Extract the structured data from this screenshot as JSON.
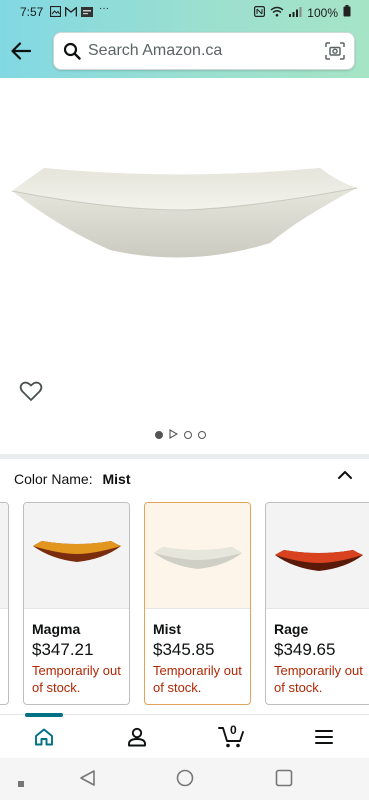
{
  "status_bar": {
    "time": "7:57",
    "battery": "100%"
  },
  "search": {
    "placeholder": "Search Amazon.ca"
  },
  "product": {
    "carousel_dots": 4,
    "active_dot": 0
  },
  "variation": {
    "label": "Color Name:",
    "selected": "Mist",
    "options": [
      {
        "name": "Magma",
        "price": "$347.21",
        "stock": "Temporarily out of stock.",
        "color": "#e3961d"
      },
      {
        "name": "Mist",
        "price": "$345.85",
        "stock": "Temporarily out of stock.",
        "color": "#e7e6dc"
      },
      {
        "name": "Rage",
        "price": "$349.65",
        "stock": "Temporarily out of stock.",
        "color": "#d8421e"
      }
    ]
  },
  "bottom_nav": {
    "cart_count": "0",
    "active": "home"
  },
  "colors": {
    "accent": "#007185",
    "price_alert": "#b12704",
    "header_start": "#82d8e3",
    "header_end": "#a6e4c6"
  }
}
